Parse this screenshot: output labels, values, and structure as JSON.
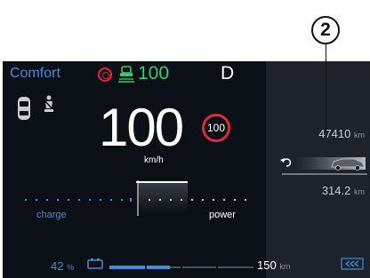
{
  "callout": {
    "number": "2"
  },
  "cluster": {
    "drive_mode": "Comfort",
    "set_speed": "100",
    "gear": "D",
    "speed": "100",
    "speed_unit": "km/h",
    "speed_limit": "100",
    "power_gauge": {
      "charge_label": "charge",
      "power_label": "power"
    },
    "odometer": {
      "value": "47410",
      "unit": "km"
    },
    "range": {
      "value": "314.2",
      "unit": "km"
    },
    "battery": {
      "percent": "42",
      "percent_unit": "%",
      "range_value": "150",
      "range_unit": "km",
      "level": 0.42
    },
    "colors": {
      "accent_blue": "#3c8ede",
      "assist_green": "#2ecf6a",
      "warning_red": "#e8243a",
      "background": "#0b1016",
      "panel": "#1e232b"
    },
    "icons": [
      "steering-warning-icon",
      "driving-assistance-icon",
      "car-top-view-icon",
      "seatbelt-icon",
      "speed-limit-sign",
      "range-car-icon",
      "battery-icon",
      "regen-brake-icon"
    ]
  }
}
